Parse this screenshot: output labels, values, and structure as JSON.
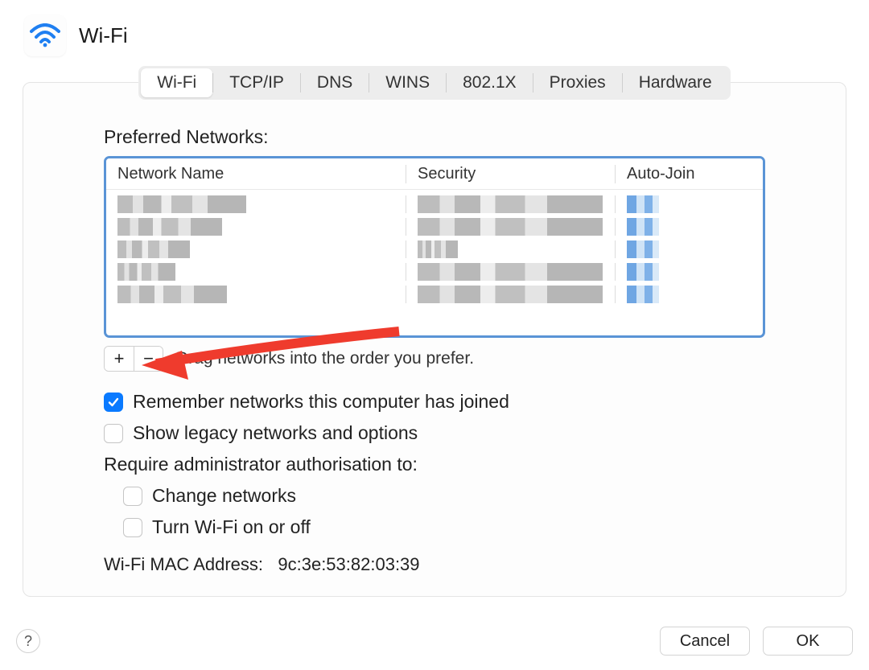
{
  "header": {
    "title": "Wi-Fi"
  },
  "tabs": [
    {
      "label": "Wi-Fi",
      "active": true
    },
    {
      "label": "TCP/IP",
      "active": false
    },
    {
      "label": "DNS",
      "active": false
    },
    {
      "label": "WINS",
      "active": false
    },
    {
      "label": "802.1X",
      "active": false
    },
    {
      "label": "Proxies",
      "active": false
    },
    {
      "label": "Hardware",
      "active": false
    }
  ],
  "preferred_networks": {
    "label": "Preferred Networks:",
    "columns": {
      "name": "Network Name",
      "security": "Security",
      "autojoin": "Auto-Join"
    },
    "rows": [
      {
        "name": "",
        "security": "",
        "autojoin": ""
      },
      {
        "name": "",
        "security": "",
        "autojoin": ""
      },
      {
        "name": "",
        "security": "",
        "autojoin": ""
      },
      {
        "name": "",
        "security": "",
        "autojoin": ""
      },
      {
        "name": "",
        "security": "",
        "autojoin": ""
      }
    ],
    "add_label": "+",
    "remove_label": "−",
    "hint": "Drag networks into the order you prefer."
  },
  "options": {
    "remember": {
      "checked": true,
      "label": "Remember networks this computer has joined"
    },
    "legacy": {
      "checked": false,
      "label": "Show legacy networks and options"
    },
    "admin_label": "Require administrator authorisation to:",
    "change": {
      "checked": false,
      "label": "Change networks"
    },
    "toggle": {
      "checked": false,
      "label": "Turn Wi-Fi on or off"
    }
  },
  "mac": {
    "label": "Wi-Fi MAC Address:",
    "value": "9c:3e:53:82:03:39"
  },
  "footer": {
    "help": "?",
    "cancel": "Cancel",
    "ok": "OK"
  }
}
